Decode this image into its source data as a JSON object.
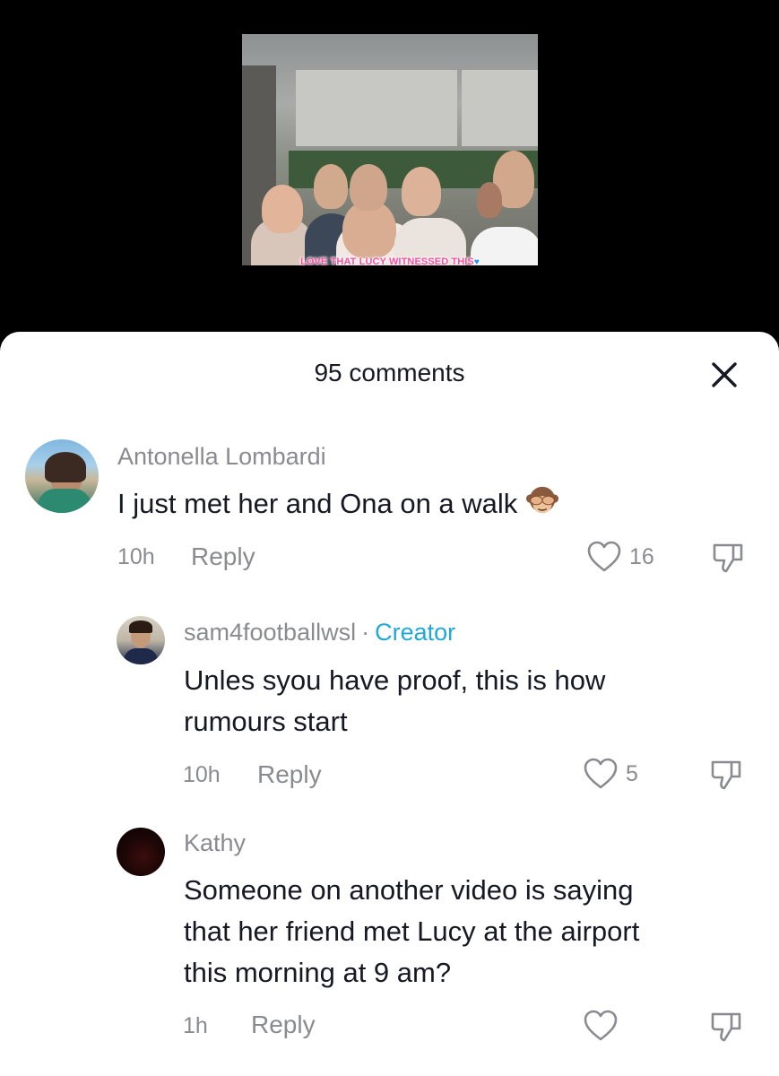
{
  "video": {
    "caption": "LOVE THAT LUCY WITNESSED THIS",
    "caption_emoji": "blue-heart"
  },
  "sheet": {
    "title": "95 comments",
    "close_icon": "close-icon"
  },
  "comments": [
    {
      "username": "Antonella Lombardi",
      "text": "I just met her and Ona on a walk",
      "emoji": "see-no-evil-monkey",
      "time": "10h",
      "reply_label": "Reply",
      "likes": "16"
    },
    {
      "username": "sam4footballwsl",
      "separator": "·",
      "badge": "Creator",
      "text_line1": "Unles syou have proof, this is how",
      "text_line2": "rumours start",
      "time": "10h",
      "reply_label": "Reply",
      "likes": "5"
    },
    {
      "username": "Kathy",
      "text_line1": "Someone on another video is saying",
      "text_line2": "that her friend met Lucy at the airport",
      "text_line3": "this morning at 9 am?",
      "time": "1h",
      "reply_label": "Reply",
      "likes": ""
    }
  ],
  "colors": {
    "accent_creator": "#20a8d8",
    "muted": "#8a8b91",
    "text": "#161823"
  }
}
